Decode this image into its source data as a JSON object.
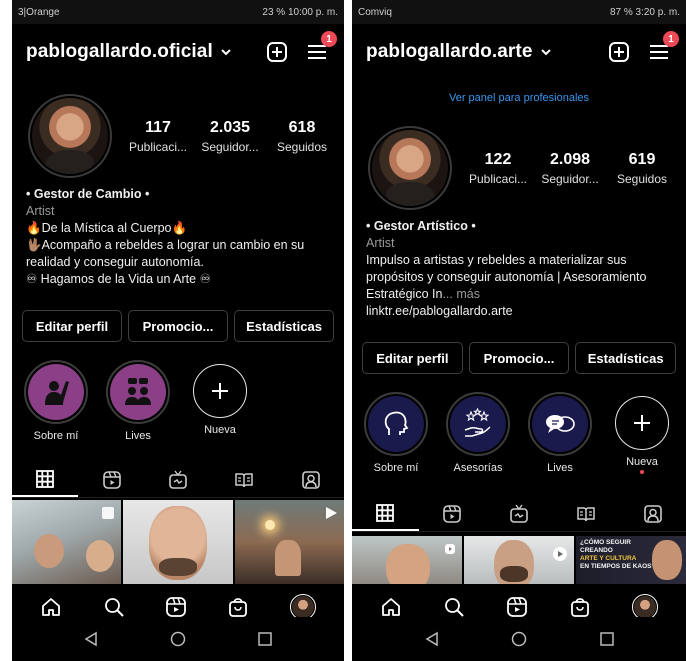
{
  "left": {
    "status": {
      "left": "3|Orange",
      "right": "23 % 10:00 p. m."
    },
    "username": "pablogallardo.oficial",
    "notifications": "1",
    "stats": [
      {
        "num": "117",
        "label": "Publicaci..."
      },
      {
        "num": "2.035",
        "label": "Seguidor..."
      },
      {
        "num": "618",
        "label": "Seguidos"
      }
    ],
    "bio": {
      "name": "• Gestor de Cambio •",
      "category": "Artist",
      "line1": "🔥De la Mística al Cuerpo🔥",
      "line2": "🖖🏽Acompaño a rebeldes a lograr un cambio en su realidad y conseguir autonomía.",
      "line3": "♾ Hagamos de la Vida un Arte ♾"
    },
    "buttons": [
      "Editar perfil",
      "Promocio...",
      "Estadísticas"
    ],
    "highlights": [
      {
        "label": "Sobre mí",
        "color": "#8b3f86",
        "icon": "raised-hand-person-icon"
      },
      {
        "label": "Lives",
        "color": "#8b3f86",
        "icon": "people-chat-icon"
      }
    ],
    "new_label": "Nueva"
  },
  "right": {
    "status": {
      "left": "Comviq",
      "right": "87 % 3:20 p. m."
    },
    "username": "pablogallardo.arte",
    "notifications": "1",
    "pro_link": "Ver panel para profesionales",
    "stats": [
      {
        "num": "122",
        "label": "Publicaci..."
      },
      {
        "num": "2.098",
        "label": "Seguidor..."
      },
      {
        "num": "619",
        "label": "Seguidos"
      }
    ],
    "bio": {
      "name": "• Gestor Artístico •",
      "category": "Artist",
      "text": "Impulso a artistas y rebeldes a materializar sus propósitos y conseguir autonomía | Asesoramiento Estratégico In",
      "more": "... más",
      "link": "linktr.ee/pablogallardo.arte"
    },
    "buttons": [
      "Editar perfil",
      "Promocio...",
      "Estadísticas"
    ],
    "highlights": [
      {
        "label": "Sobre mí",
        "color": "#1b1a4d",
        "icon": "head-outline-icon"
      },
      {
        "label": "Asesorías",
        "color": "#1b1a4d",
        "icon": "stars-hand-icon"
      },
      {
        "label": "Lives",
        "color": "#1b1a4d",
        "icon": "speech-bubbles-icon"
      }
    ],
    "new_label": "Nueva",
    "promo_post": {
      "l1": "¿CÓMO SEGUIR",
      "l2": "CREANDO",
      "l3": "ARTE Y CULTURA",
      "l4": "EN TIEMPOS DE KAOS?"
    }
  },
  "colors": {
    "background": "#000000",
    "link": "#3897f0",
    "badge": "#ed4956"
  }
}
